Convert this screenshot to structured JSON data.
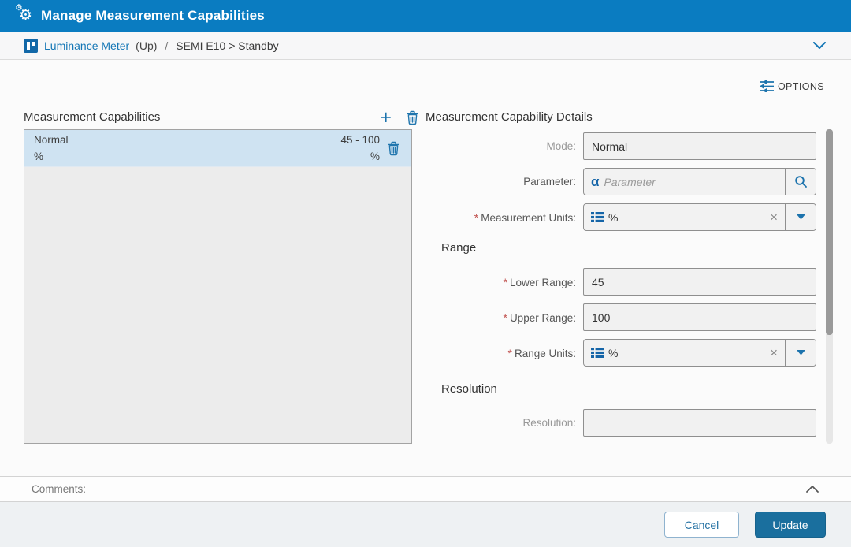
{
  "header": {
    "title": "Manage Measurement Capabilities"
  },
  "breadcrumb": {
    "equipment": "Luminance Meter",
    "up": "(Up)",
    "separator": "/",
    "path": "SEMI E10 > Standby"
  },
  "toolbar": {
    "options_label": "OPTIONS"
  },
  "capabilities_list": {
    "title": "Measurement Capabilities",
    "items": [
      {
        "mode": "Normal",
        "units": "%",
        "range": "45 - 100",
        "range_units": "%"
      }
    ]
  },
  "details": {
    "title": "Measurement Capability Details",
    "required_mark": "*",
    "mode": {
      "label": "Mode:",
      "value": "Normal"
    },
    "parameter": {
      "label": "Parameter:",
      "placeholder": "Parameter"
    },
    "measurement_units": {
      "label": "Measurement Units:",
      "value": "%"
    },
    "range_section": "Range",
    "lower_range": {
      "label": "Lower Range:",
      "value": "45"
    },
    "upper_range": {
      "label": "Upper Range:",
      "value": "100"
    },
    "range_units": {
      "label": "Range Units:",
      "value": "%"
    },
    "resolution_section": "Resolution",
    "resolution": {
      "label": "Resolution:",
      "value": ""
    }
  },
  "comments": {
    "label": "Comments:"
  },
  "footer": {
    "cancel_label": "Cancel",
    "update_label": "Update"
  },
  "colors": {
    "header_blue": "#0a7cc1",
    "accent_blue": "#1c73ad",
    "link_blue": "#1577b6",
    "update_blue": "#1a6f9e",
    "selected_row": "#cfe3f2",
    "required_red": "#c0504d"
  }
}
